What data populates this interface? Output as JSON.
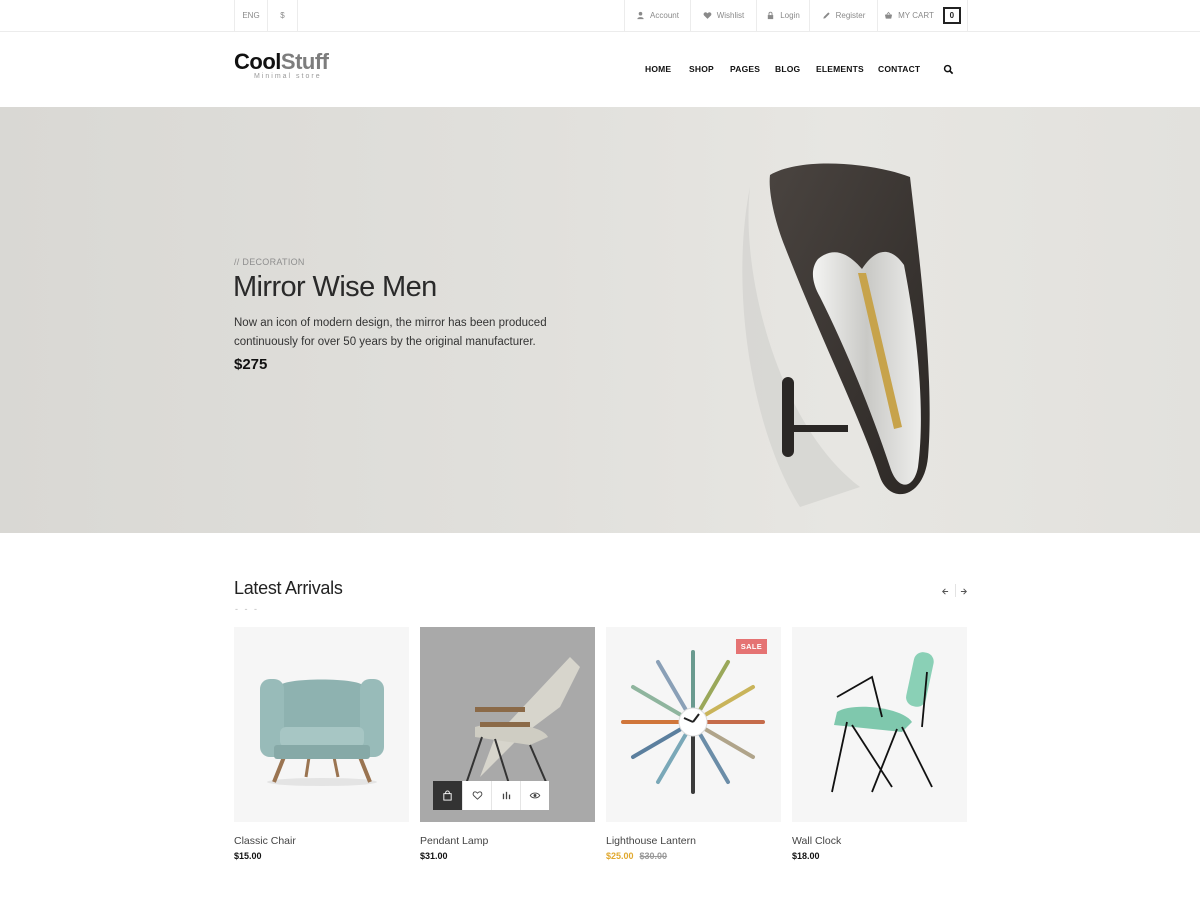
{
  "topbar": {
    "language": "ENG",
    "currency": "$",
    "account": "Account",
    "wishlist": "Wishlist",
    "login": "Login",
    "register": "Register",
    "cart_label": "MY CART",
    "cart_count": "0"
  },
  "logo": {
    "main_a": "Cool",
    "main_b": "Stuff",
    "tagline": "Minimal store"
  },
  "nav": {
    "items": [
      "HOME",
      "SHOP",
      "PAGES",
      "BLOG",
      "ELEMENTS",
      "CONTACT"
    ]
  },
  "hero": {
    "kicker": "// DECORATION",
    "title": "Mirror Wise Men",
    "description": "Now an icon of modern design, the mirror has been produced continuously for over 50 years by the original manufacturer.",
    "price": "$275"
  },
  "arrivals": {
    "title": "Latest Arrivals",
    "dots": "- - -",
    "products": [
      {
        "name": "Classic Chair",
        "price": "$15.00"
      },
      {
        "name": "Pendant Lamp",
        "price": "$31.00"
      },
      {
        "name": "Lighthouse Lantern",
        "price": "$25.00",
        "old_price": "$30.00",
        "badge": "SALE"
      },
      {
        "name": "Wall Clock",
        "price": "$18.00"
      }
    ]
  },
  "colors": {
    "accent_sale_price": "#e0a82e",
    "sale_badge": "#e57373",
    "text_dark": "#111111"
  }
}
